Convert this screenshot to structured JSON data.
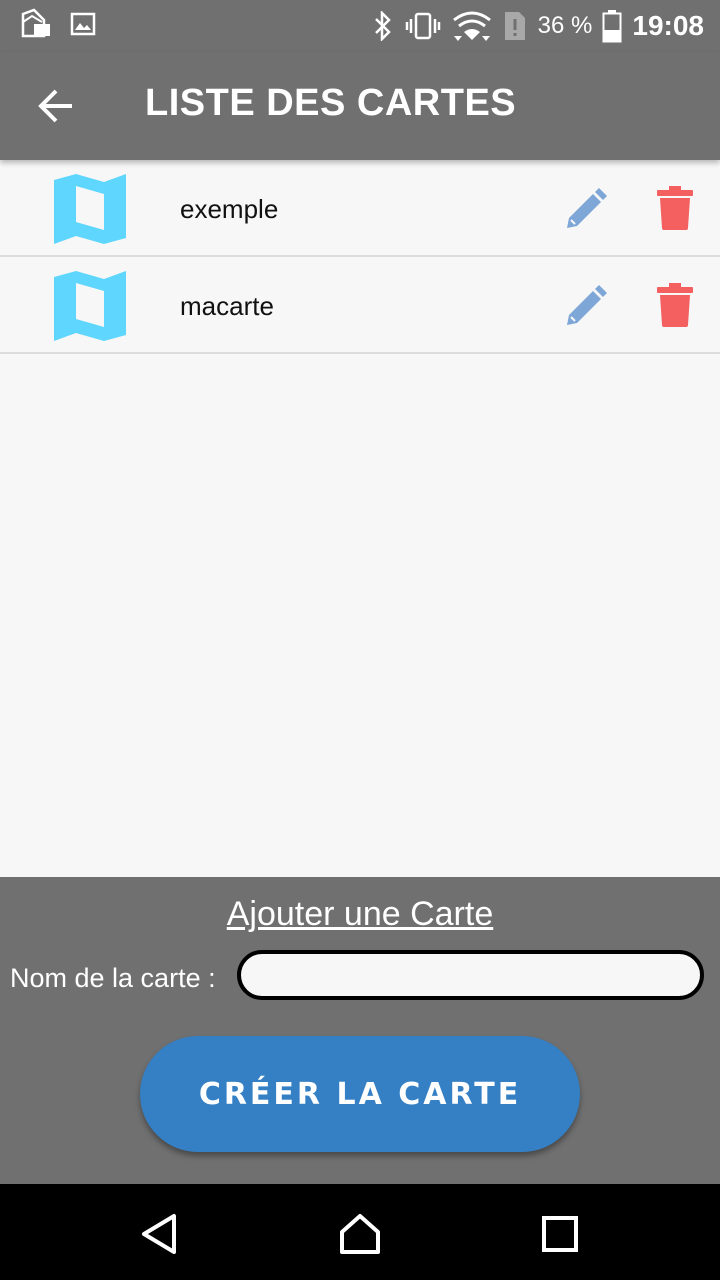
{
  "status_bar": {
    "battery_text": "36 %",
    "time": "19:08",
    "icons": [
      "app-notification-icon",
      "image-notification-icon",
      "bluetooth-icon",
      "vibrate-icon",
      "wifi-icon",
      "sim-alert-icon",
      "battery-icon"
    ]
  },
  "app_bar": {
    "title": "LISTE DES CARTES",
    "back_icon": "arrow-left-icon"
  },
  "cards": [
    {
      "name": "exemple"
    },
    {
      "name": "macarte"
    }
  ],
  "add_panel": {
    "title": "Ajouter une Carte",
    "field_label": "Nom de la carte :",
    "input_value": "",
    "create_button": "CRÉER LA CARTE"
  },
  "colors": {
    "bar_gray": "#707070",
    "map_icon": "#5fd6fd",
    "edit_icon": "#7ea6d6",
    "delete_icon": "#f45f5f",
    "button_blue": "#3580c4"
  }
}
